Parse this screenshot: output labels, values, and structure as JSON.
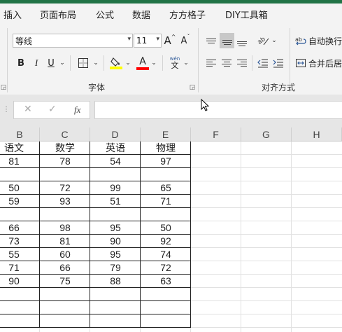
{
  "menu": {
    "tabs": [
      "插入",
      "页面布局",
      "公式",
      "数据",
      "方方格子",
      "DIY工具箱"
    ]
  },
  "ribbon": {
    "font_name": "等线",
    "font_size": "11",
    "grow_font_glyph": "A",
    "shrink_font_glyph": "A",
    "bold": "B",
    "italic": "I",
    "underline": "U",
    "font_color_glyph": "A",
    "phonetic_top": "wén",
    "phonetic_bottom": "文",
    "font_group_label": "字体",
    "alignment_group_label": "对齐方式",
    "wrap_text_label": "自动换行",
    "merge_center_label": "合并后居",
    "fill_color": "#ffff00",
    "font_color": "#ff0000"
  },
  "formula_bar": {
    "cancel_glyph": "✕",
    "enter_glyph": "✓",
    "fx_glyph": "fx",
    "content": ""
  },
  "columns": [
    "B",
    "C",
    "D",
    "E",
    "F",
    "G",
    "H"
  ],
  "table": {
    "headers": [
      "语文",
      "数学",
      "英语",
      "物理"
    ],
    "rows": [
      [
        "81",
        "78",
        "54",
        "97"
      ],
      [
        "",
        "",
        "",
        ""
      ],
      [
        "50",
        "72",
        "99",
        "65"
      ],
      [
        "59",
        "93",
        "51",
        "71"
      ],
      [
        "",
        "",
        "",
        ""
      ],
      [
        "66",
        "98",
        "95",
        "50"
      ],
      [
        "73",
        "81",
        "90",
        "92"
      ],
      [
        "55",
        "60",
        "95",
        "74"
      ],
      [
        "71",
        "66",
        "79",
        "72"
      ],
      [
        "90",
        "75",
        "88",
        "63"
      ],
      [
        "",
        "",
        "",
        ""
      ],
      [
        "",
        "",
        "",
        ""
      ],
      [
        "",
        "",
        "",
        ""
      ]
    ]
  },
  "colors": {
    "brand_green": "#217346",
    "ribbon_bg": "#f3f3f3"
  }
}
